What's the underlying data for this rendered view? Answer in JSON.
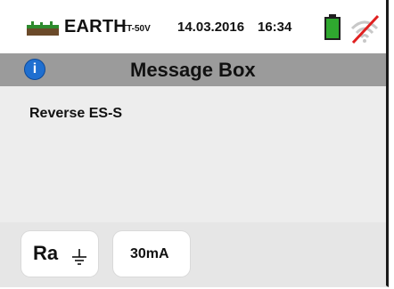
{
  "status_bar": {
    "mode_name": "EARTH",
    "mode_sub": "TT-50V",
    "date": "14.03.2016",
    "time": "16:34",
    "icons": [
      "earth-ground-icon",
      "battery-icon",
      "wifi-off-icon"
    ],
    "battery_color": "#2fa82f",
    "wifi_off_color": "#e02020"
  },
  "title_bar": {
    "title": "Message Box",
    "icon": "info-icon",
    "background": "#9b9b9b",
    "info_color": "#1f6fd0"
  },
  "content": {
    "message": "Reverse ES-S"
  },
  "footer": {
    "keys": [
      {
        "label": "Ra",
        "icon": "ground-icon"
      },
      {
        "label": "30mA"
      }
    ]
  }
}
